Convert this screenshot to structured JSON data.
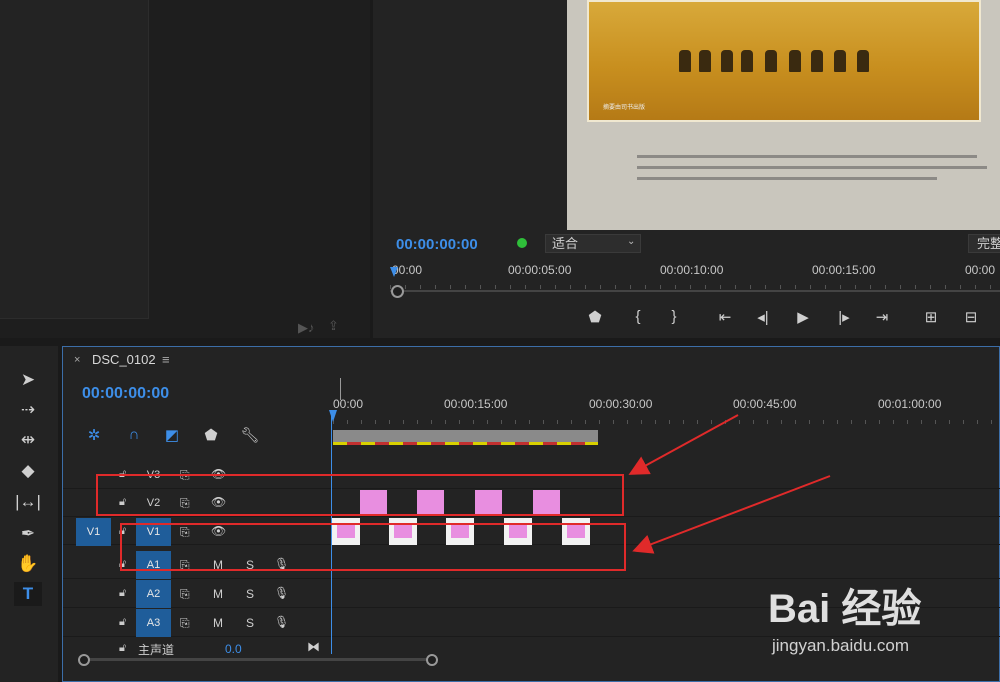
{
  "program": {
    "timecode": "00:00:00:00",
    "fit": "适合",
    "quality": "完整",
    "ruler_ticks": [
      "00:00",
      "00:00:05:00",
      "00:00:10:00",
      "00:00:15:00",
      "00:00"
    ],
    "caption": "摘要由司书出版"
  },
  "timeline": {
    "sequence_name": "DSC_0102",
    "menu_icon": "≡",
    "timecode": "00:00:00:00",
    "ruler_ticks": [
      "00:00",
      "00:00:15:00",
      "00:00:30:00",
      "00:00:45:00",
      "00:01:00:00"
    ],
    "tracks": [
      {
        "label": "V3",
        "type": "video"
      },
      {
        "label": "V2",
        "type": "video"
      },
      {
        "label": "V1",
        "type": "video",
        "source_patch": "V1"
      },
      {
        "label": "A1",
        "type": "audio",
        "mute": "M",
        "solo": "S"
      },
      {
        "label": "A2",
        "type": "audio",
        "mute": "M",
        "solo": "S"
      },
      {
        "label": "A3",
        "type": "audio",
        "mute": "M",
        "solo": "S"
      }
    ],
    "master_label": "主声道",
    "master_value": "0.0"
  },
  "watermark": {
    "brand": "Bai 经验",
    "url": "jingyan.baidu.com"
  },
  "colors": {
    "accent": "#3d8ee8",
    "clip": "#e88ee0",
    "annotation": "#e02a2a"
  }
}
